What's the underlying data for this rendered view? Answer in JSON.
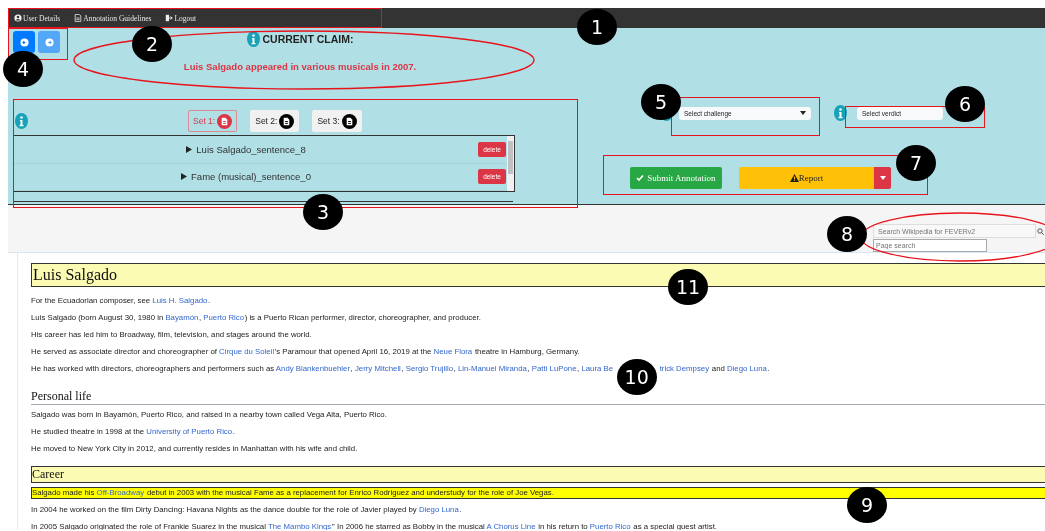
{
  "nav": [
    {
      "label": "User Details"
    },
    {
      "label": "Annotation Guidelines"
    },
    {
      "label": "Logout"
    }
  ],
  "claim": {
    "heading": "CURRENT CLAIM:",
    "text": "Luis Salgado appeared in various musicals in 2007."
  },
  "evidence_sets": [
    {
      "label": "Set 1:",
      "selected": true
    },
    {
      "label": "Set 2:",
      "selected": false
    },
    {
      "label": "Set 3:",
      "selected": false
    }
  ],
  "evidence": [
    {
      "label": "Luis Salgado_sentence_8",
      "expanded": false,
      "button": "delete"
    },
    {
      "label": "Fame (musical)_sentence_0",
      "expanded": false,
      "button": "delete"
    }
  ],
  "challenge_select": {
    "value": "Select challenge"
  },
  "verdict_select": {
    "value": "Select verdict"
  },
  "submit_button": "Submit Annotation",
  "report_button": "Report",
  "search": {
    "placeholder": "Search Wikipedia for FEVERv2"
  },
  "page_search": {
    "placeholder": "Page search"
  },
  "sections": [
    {
      "heading": "Luis Salgado",
      "kind": "title",
      "highlighted": true,
      "paragraphs": [
        {
          "highlighted": false,
          "runs": [
            {
              "text": "For the Ecuadorian composer, see "
            },
            {
              "text": "Luis H. Salgado",
              "link": true
            },
            {
              "text": "."
            }
          ]
        },
        {
          "highlighted": false,
          "runs": [
            {
              "text": "Luis Salgado (born August 30, 1980 in "
            },
            {
              "text": "Bayamón",
              "link": true
            },
            {
              "text": ", "
            },
            {
              "text": "Puerto Rico",
              "link": true
            },
            {
              "text": ") is a Puerto Rican performer, director, choreographer, and producer."
            }
          ]
        },
        {
          "highlighted": false,
          "runs": [
            {
              "text": "His career has led him to Broadway, film, television, and stages around the world."
            }
          ]
        },
        {
          "highlighted": false,
          "runs": [
            {
              "text": "He served as associate director and choreographer of "
            },
            {
              "text": "Cirque du Soleil",
              "link": true
            },
            {
              "text": "'s Paramour that opened April 16, 2019 at the "
            },
            {
              "text": "Neue Flora",
              "link": true
            },
            {
              "text": " theatre in Hamburg, Germany."
            }
          ]
        },
        {
          "highlighted": false,
          "runs": [
            {
              "text": "He has worked with directors, choreographers and performers such as "
            },
            {
              "text": "Andy Blankenbuehler",
              "link": true
            },
            {
              "text": ", "
            },
            {
              "text": "Jerry Mitchell",
              "link": true
            },
            {
              "text": ", "
            },
            {
              "text": "Sergio Trujillo",
              "link": true
            },
            {
              "text": ", "
            },
            {
              "text": "Lin-Manuel Miranda",
              "link": true
            },
            {
              "text": ", "
            },
            {
              "text": "Patti LuPone",
              "link": true
            },
            {
              "text": ", "
            },
            {
              "text": "Laura Be",
              "link": true
            },
            {
              "callout": "10"
            },
            {
              "text": "trick Dempsey",
              "link": true
            },
            {
              "text": " and "
            },
            {
              "text": "Diego Luna",
              "link": true
            },
            {
              "text": "."
            }
          ]
        }
      ]
    },
    {
      "heading": "Personal life",
      "kind": "section",
      "highlighted": false,
      "paragraphs": [
        {
          "highlighted": false,
          "runs": [
            {
              "text": "Salgado was born in Bayamón, Puerto Rico, and raised in a nearby town called Vega Alta, Puerto Rico."
            }
          ]
        },
        {
          "highlighted": false,
          "runs": [
            {
              "text": "He studied theatre in 1998 at the "
            },
            {
              "text": "University of Puerto Rico",
              "link": true
            },
            {
              "text": "."
            }
          ]
        },
        {
          "highlighted": false,
          "runs": [
            {
              "text": "He moved to New York City in 2012, and currently resides in Manhattan with his wife and child."
            }
          ]
        }
      ]
    },
    {
      "heading": "Career",
      "kind": "section",
      "highlighted": true,
      "paragraphs": [
        {
          "highlighted": true,
          "runs": [
            {
              "text": "Salgado made his "
            },
            {
              "text": "Off-Broadway",
              "link": true
            },
            {
              "text": " debut in 2003 with the musical Fame as a replacement for Enrico Rodriguez and understudy for the role of Joe Vegas."
            }
          ]
        },
        {
          "highlighted": false,
          "runs": [
            {
              "text": "In 2004 he worked on the film Dirty Dancing: Havana Nights as the dance double for the role of Javier played by "
            },
            {
              "text": "Diego Luna",
              "link": true
            },
            {
              "text": "."
            }
          ]
        },
        {
          "highlighted": false,
          "runs": [
            {
              "text": "In 2005 Salgado originated the role of Frankie Suarez in the musical "
            },
            {
              "text": "The Mambo Kings",
              "link": true
            },
            {
              "text": "'' In 2006 he starred as Bobby in the musical "
            },
            {
              "text": "A Chorus Line",
              "link": true
            },
            {
              "text": " in his return to "
            },
            {
              "text": "Puerto Rico",
              "link": true
            },
            {
              "text": " as a special guest artist."
            }
          ]
        }
      ]
    }
  ],
  "callouts": [
    "1",
    "2",
    "3",
    "4",
    "5",
    "6",
    "7",
    "8",
    "9",
    "11"
  ]
}
